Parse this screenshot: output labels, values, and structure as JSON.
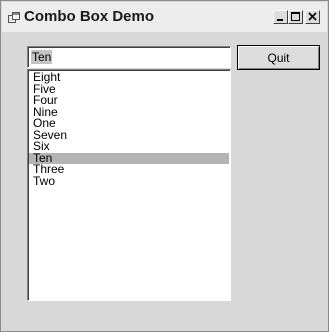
{
  "window": {
    "title": "Combo Box Demo",
    "controls": [
      "minimize-icon",
      "maximize-icon",
      "close-icon"
    ]
  },
  "combo": {
    "value": "Ten",
    "items": [
      {
        "label": "Eight",
        "selected": false
      },
      {
        "label": "Five",
        "selected": false
      },
      {
        "label": "Four",
        "selected": false
      },
      {
        "label": "Nine",
        "selected": false
      },
      {
        "label": "One",
        "selected": false
      },
      {
        "label": "Seven",
        "selected": false
      },
      {
        "label": "Six",
        "selected": false
      },
      {
        "label": "Ten",
        "selected": true
      },
      {
        "label": "Three",
        "selected": false
      },
      {
        "label": "Two",
        "selected": false
      }
    ]
  },
  "buttons": {
    "quit_label": "Quit"
  },
  "colors": {
    "window_bg": "#d8d8d8",
    "selection_bg": "#b4b4b4"
  }
}
